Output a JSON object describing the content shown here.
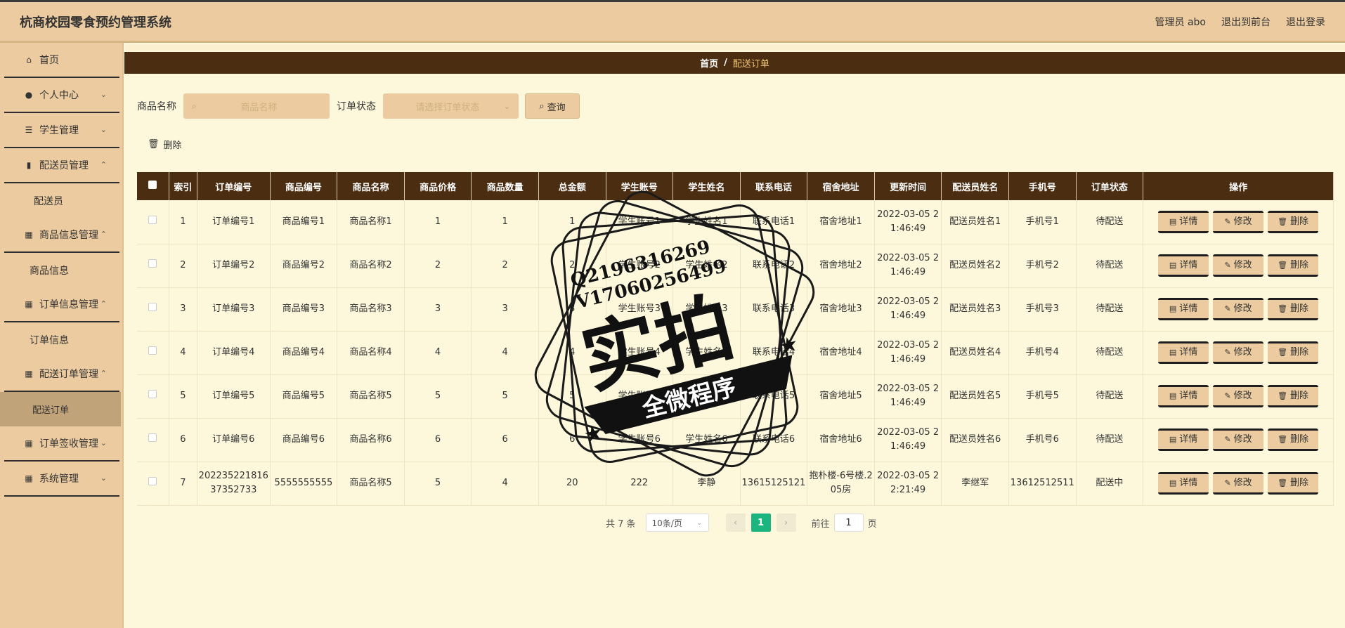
{
  "header": {
    "title": "杭商校园零食预约管理系统",
    "admin_label": "管理员 abo",
    "front_label": "退出到前台",
    "logout_label": "退出登录"
  },
  "sidebar": {
    "items": [
      {
        "label": "首页"
      },
      {
        "label": "个人中心"
      },
      {
        "label": "学生管理"
      },
      {
        "label": "配送员管理"
      },
      {
        "label": "配送员"
      },
      {
        "label": "商品信息管理"
      },
      {
        "label": "商品信息"
      },
      {
        "label": "订单信息管理"
      },
      {
        "label": "订单信息"
      },
      {
        "label": "配送订单管理"
      },
      {
        "label": "配送订单"
      },
      {
        "label": "订单签收管理"
      },
      {
        "label": "系统管理"
      }
    ]
  },
  "breadcrumb": {
    "home": "首页",
    "sep": "/",
    "current": "配送订单"
  },
  "search": {
    "name_label": "商品名称",
    "name_placeholder": "商品名称",
    "status_label": "订单状态",
    "status_placeholder": "请选择订单状态",
    "query_label": "查询"
  },
  "toolbar": {
    "delete_label": "删除"
  },
  "table": {
    "headers": [
      "索引",
      "订单编号",
      "商品编号",
      "商品名称",
      "商品价格",
      "商品数量",
      "总金额",
      "学生账号",
      "学生姓名",
      "联系电话",
      "宿舍地址",
      "更新时间",
      "配送员姓名",
      "手机号",
      "订单状态",
      "操作"
    ],
    "rows": [
      [
        "1",
        "订单编号1",
        "商品编号1",
        "商品名称1",
        "1",
        "1",
        "1",
        "学生账号1",
        "学生姓名1",
        "联系电话1",
        "宿舍地址1",
        "2022-03-05 21:46:49",
        "配送员姓名1",
        "手机号1",
        "待配送"
      ],
      [
        "2",
        "订单编号2",
        "商品编号2",
        "商品名称2",
        "2",
        "2",
        "2",
        "学生账号2",
        "学生姓名2",
        "联系电话2",
        "宿舍地址2",
        "2022-03-05 21:46:49",
        "配送员姓名2",
        "手机号2",
        "待配送"
      ],
      [
        "3",
        "订单编号3",
        "商品编号3",
        "商品名称3",
        "3",
        "3",
        "3",
        "学生账号3",
        "学生姓名3",
        "联系电话3",
        "宿舍地址3",
        "2022-03-05 21:46:49",
        "配送员姓名3",
        "手机号3",
        "待配送"
      ],
      [
        "4",
        "订单编号4",
        "商品编号4",
        "商品名称4",
        "4",
        "4",
        "4",
        "学生账号4",
        "学生姓名4",
        "联系电话4",
        "宿舍地址4",
        "2022-03-05 21:46:49",
        "配送员姓名4",
        "手机号4",
        "待配送"
      ],
      [
        "5",
        "订单编号5",
        "商品编号5",
        "商品名称5",
        "5",
        "5",
        "5",
        "学生账号5",
        "学生姓名5",
        "联系电话5",
        "宿舍地址5",
        "2022-03-05 21:46:49",
        "配送员姓名5",
        "手机号5",
        "待配送"
      ],
      [
        "6",
        "订单编号6",
        "商品编号6",
        "商品名称6",
        "6",
        "6",
        "6",
        "学生账号6",
        "学生姓名6",
        "联系电话6",
        "宿舍地址6",
        "2022-03-05 21:46:49",
        "配送员姓名6",
        "手机号6",
        "待配送"
      ],
      [
        "7",
        "20223522181637352733",
        "5555555555",
        "商品名称5",
        "5",
        "4",
        "20",
        "222",
        "李静",
        "13615125121",
        "抱朴楼-6号楼.205房",
        "2022-03-05 22:21:49",
        "李继军",
        "13612512511",
        "配送中"
      ]
    ],
    "ops": {
      "detail": "详情",
      "edit": "修改",
      "delete": "删除"
    }
  },
  "pager": {
    "total": "共 7 条",
    "size": "10条/页",
    "current_page": "1",
    "goto_label": "前往",
    "goto_value": "1",
    "page_suffix": "页"
  },
  "watermark": {
    "line1": "Q2196316269",
    "line2": "V17060256499",
    "main": "实拍",
    "banner": "全微程序"
  },
  "colors": {
    "header_bg": "#ebcb9f",
    "table_header_bg": "#4b2e12",
    "page_bg": "#fdf8dc",
    "active_page": "#1bb57f"
  }
}
